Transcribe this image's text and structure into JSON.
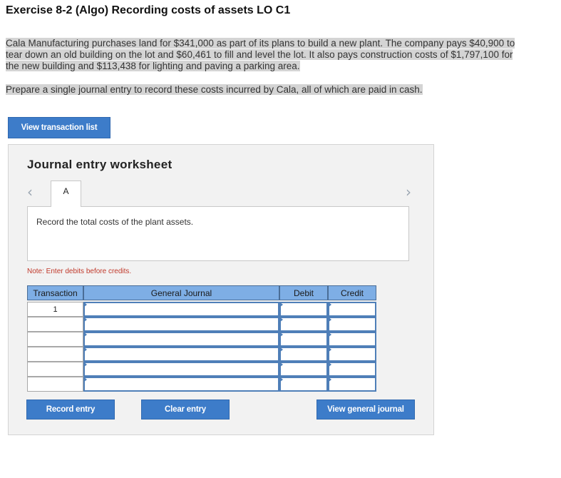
{
  "title": "Exercise 8-2 (Algo) Recording costs of assets LO C1",
  "problem_text": [
    "Cala Manufacturing purchases land for $341,000 as part of its plans to build a new plant. The company pays $40,900 to",
    "tear down an old building on the lot and $60,461 to fill and level the lot. It also pays construction costs of $1,797,100 for",
    "the new building and $113,438 for lighting and paving a parking area."
  ],
  "instruction": "Prepare a single journal entry to record these costs incurred by Cala, all of which are paid in cash.",
  "buttons": {
    "view_transaction_list": "View transaction list",
    "record_entry": "Record entry",
    "clear_entry": "Clear entry",
    "view_general_journal": "View general journal"
  },
  "worksheet": {
    "title": "Journal entry worksheet",
    "prev_glyph": "‹",
    "next_glyph": "›",
    "active_tab": "A",
    "description": "Record the total costs of the plant assets.",
    "note": "Note: Enter debits before credits."
  },
  "journal": {
    "headers": {
      "transaction": "Transaction",
      "general_journal": "General Journal",
      "debit": "Debit",
      "credit": "Credit"
    },
    "rows": [
      {
        "transaction": "1",
        "account": "",
        "debit": "",
        "credit": ""
      },
      {
        "transaction": "",
        "account": "",
        "debit": "",
        "credit": ""
      },
      {
        "transaction": "",
        "account": "",
        "debit": "",
        "credit": ""
      },
      {
        "transaction": "",
        "account": "",
        "debit": "",
        "credit": ""
      },
      {
        "transaction": "",
        "account": "",
        "debit": "",
        "credit": ""
      },
      {
        "transaction": "",
        "account": "",
        "debit": "",
        "credit": ""
      }
    ]
  },
  "colors": {
    "button_blue": "#3d7cc9",
    "header_blue": "#7eaee5",
    "note_red": "#c0392b",
    "highlight_gray": "#d4d4d4"
  }
}
